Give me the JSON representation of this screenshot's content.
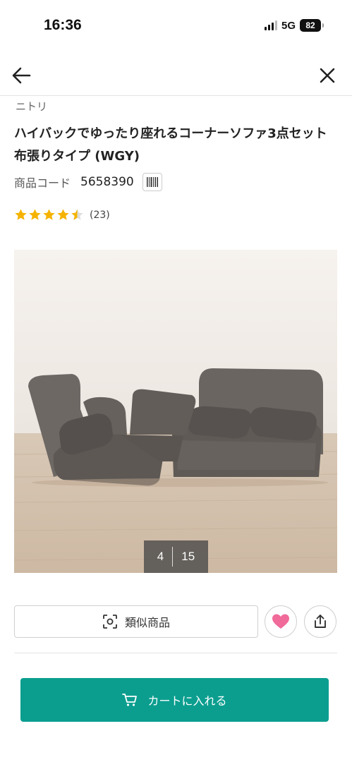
{
  "status_bar": {
    "time": "16:36",
    "network": "5G",
    "battery": "82"
  },
  "nav": {
    "back_icon": "arrow-left-icon",
    "close_icon": "close-icon"
  },
  "product": {
    "brand": "ニトリ",
    "title": "ハイバックでゆったり座れるコーナーソファ3点セット 布張りタイプ (WGY)",
    "code_label": "商品コード",
    "code_value": "5658390",
    "rating": 4.5,
    "review_count": "(23)"
  },
  "gallery": {
    "current": "4",
    "total": "15"
  },
  "actions": {
    "similar_label": "類似商品",
    "favorite_icon": "heart-icon",
    "share_icon": "share-icon",
    "cart_label": "カートに入れる"
  },
  "colors": {
    "accent": "#0b9e8f",
    "star": "#f5b300",
    "heart": "#f06a9a"
  }
}
